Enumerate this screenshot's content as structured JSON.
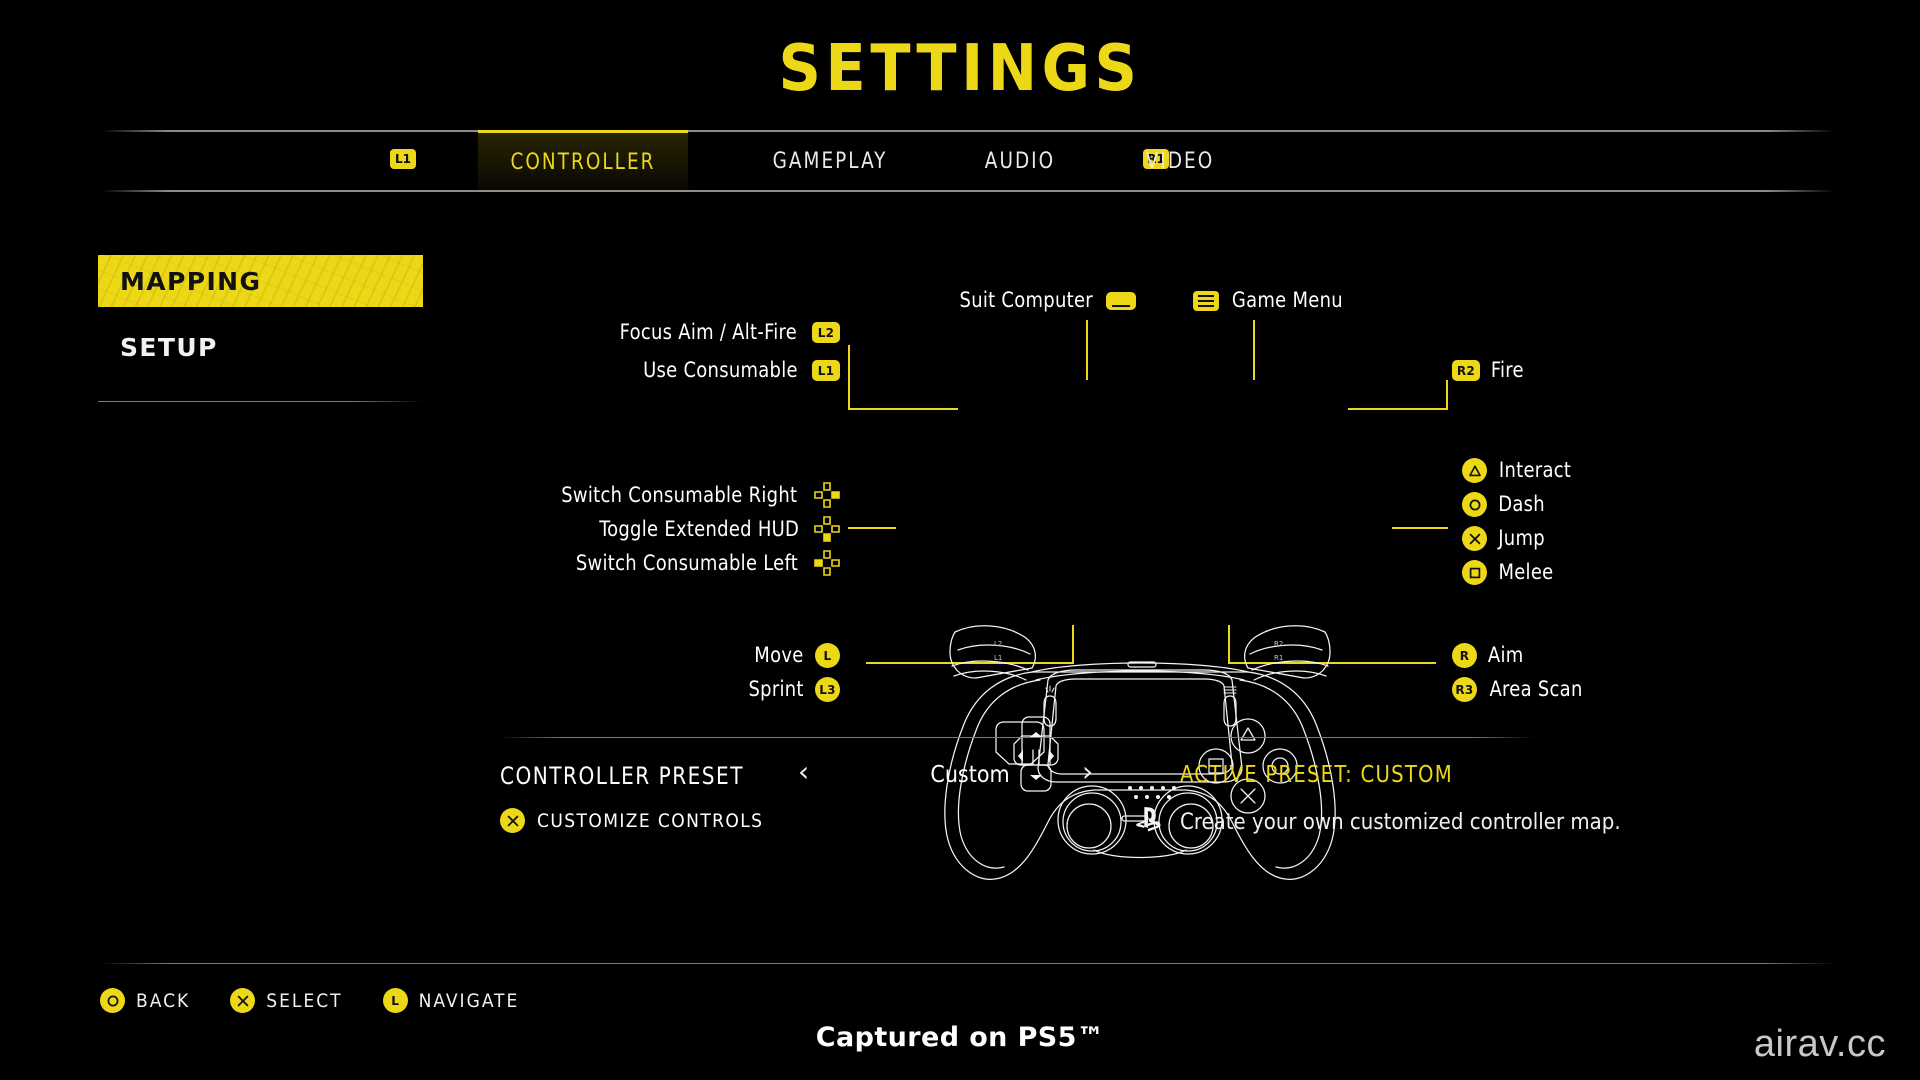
{
  "page": {
    "title": "SETTINGS",
    "accent_color": "#EDD817",
    "background_color": "#000000",
    "text_color": "#FFFFFF",
    "captured_note": "Captured on PS5™",
    "watermark": "airav.cc"
  },
  "tabbar": {
    "prev_badge": "L1",
    "next_badge": "R1",
    "tabs": [
      {
        "label": "CONTROLLER",
        "active": true
      },
      {
        "label": "GAMEPLAY",
        "active": false
      },
      {
        "label": "AUDIO",
        "active": false
      },
      {
        "label": "VIDEO",
        "active": false
      }
    ]
  },
  "sidebar": {
    "items": [
      {
        "label": "MAPPING",
        "selected": true
      },
      {
        "label": "SETUP",
        "selected": false
      }
    ]
  },
  "mapping": {
    "top_labels": [
      {
        "label": "Suit Computer",
        "icon": "touchpad-icon",
        "icon_side": "right"
      },
      {
        "label": "Game Menu",
        "icon": "options-menu-icon",
        "icon_side": "left"
      }
    ],
    "left_top": [
      {
        "label": "Focus Aim / Alt-Fire",
        "button": "L2",
        "icon": "l2-badge-icon"
      },
      {
        "label": "Use Consumable",
        "button": "L1",
        "icon": "l1-badge-icon"
      }
    ],
    "left_dpad": [
      {
        "label": "Switch Consumable Right",
        "icon": "dpad-right-icon"
      },
      {
        "label": "Toggle Extended HUD",
        "icon": "dpad-down-icon"
      },
      {
        "label": "Switch Consumable Left",
        "icon": "dpad-left-icon"
      }
    ],
    "left_sticks": [
      {
        "label": "Move",
        "button": "L",
        "icon": "left-stick-icon"
      },
      {
        "label": "Sprint",
        "button": "L3",
        "icon": "left-stick-press-icon"
      }
    ],
    "right_top": [
      {
        "label": "Fire",
        "button": "R2",
        "icon": "r2-badge-icon"
      }
    ],
    "right_face": [
      {
        "label": "Interact",
        "icon": "triangle-button-icon"
      },
      {
        "label": "Dash",
        "icon": "circle-button-icon"
      },
      {
        "label": "Jump",
        "icon": "cross-button-icon"
      },
      {
        "label": "Melee",
        "icon": "square-button-icon"
      }
    ],
    "right_sticks": [
      {
        "label": "Aim",
        "button": "R",
        "icon": "right-stick-icon"
      },
      {
        "label": "Area Scan",
        "button": "R3",
        "icon": "right-stick-press-icon"
      }
    ]
  },
  "preset": {
    "label": "CONTROLLER PRESET",
    "value": "Custom",
    "left_arrow": "‹",
    "right_arrow": "›",
    "customize_label": "CUSTOMIZE CONTROLS",
    "customize_button": "×",
    "active_preset": "ACTIVE PRESET: CUSTOM",
    "description": "Create your own customized controller map."
  },
  "footer": {
    "actions": [
      {
        "label": "BACK",
        "icon": "circle-button-icon"
      },
      {
        "label": "SELECT",
        "icon": "cross-button-icon"
      },
      {
        "label": "NAVIGATE",
        "icon": "left-stick-icon"
      }
    ]
  }
}
